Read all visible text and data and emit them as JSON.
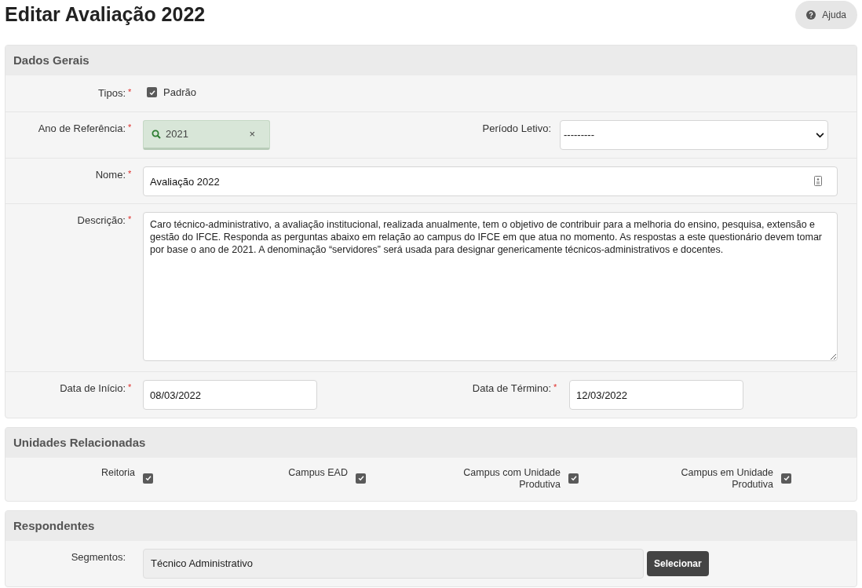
{
  "title": "Editar Avaliação 2022",
  "help_button": {
    "label": "Ajuda"
  },
  "dados_gerais": {
    "title": "Dados Gerais",
    "tipos": {
      "label": "Tipos:",
      "required_mark": "*",
      "option": {
        "label": "Padrão",
        "checked": true
      }
    },
    "ano_referencia": {
      "label": "Ano de Referência:",
      "required_mark": "*",
      "value": "2021",
      "clear": "×"
    },
    "periodo_letivo": {
      "label": "Período Letivo:",
      "value": "---------"
    },
    "nome": {
      "label": "Nome:",
      "required_mark": "*",
      "value": "Avaliação 2022"
    },
    "descricao": {
      "label": "Descrição:",
      "required_mark": "*",
      "value": "Caro técnico-administrativo, a avaliação institucional, realizada anualmente, tem o objetivo de contribuir para a melhoria do ensino, pesquisa, extensão e gestão do IFCE. Responda as perguntas abaixo em relação ao campus do IFCE em que atua no momento. As respostas a este questionário devem tomar por base o ano de 2021. A denominação “servidores” será usada para designar genericamente técnicos-administrativos e docentes."
    },
    "data_inicio": {
      "label": "Data de Início:",
      "required_mark": "*",
      "value": "08/03/2022"
    },
    "data_termino": {
      "label": "Data de Término:",
      "required_mark": "*",
      "value": "12/03/2022"
    }
  },
  "unidades_relacionadas": {
    "title": "Unidades Relacionadas",
    "items": [
      {
        "label": "Reitoria",
        "checked": true
      },
      {
        "label": "Campus EAD",
        "checked": true
      },
      {
        "label": "Campus com Unidade Produtiva",
        "checked": true
      },
      {
        "label": "Campus em Unidade Produtiva",
        "checked": true
      }
    ]
  },
  "respondentes": {
    "title": "Respondentes",
    "segmentos": {
      "label": "Segmentos:",
      "value": "Técnico Administrativo",
      "button": "Selecionar"
    }
  }
}
